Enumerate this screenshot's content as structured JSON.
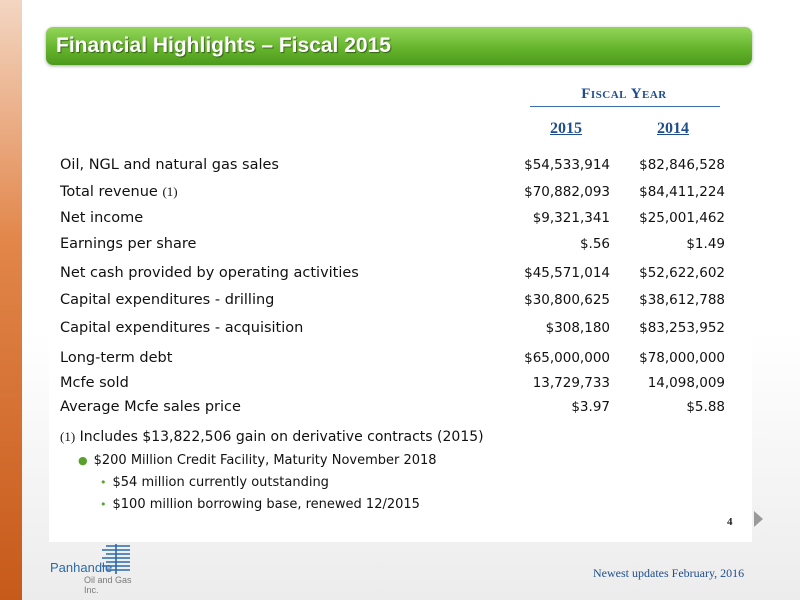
{
  "title": "Financial Highlights – Fiscal 2015",
  "table": {
    "group_header": "Fiscal Year",
    "years": [
      "2015",
      "2014"
    ],
    "rows": [
      {
        "label": "Oil, NGL and natural gas sales",
        "note": "",
        "v2015": "$54,533,914",
        "v2014": "$82,846,528"
      },
      {
        "label": "Total revenue",
        "note": "(1)",
        "v2015": "$70,882,093",
        "v2014": "$84,411,224"
      },
      {
        "label": "Net income",
        "note": "",
        "v2015": "$9,321,341",
        "v2014": "$25,001,462"
      },
      {
        "label": "Earnings per share",
        "note": "",
        "v2015": "$.56",
        "v2014": "$1.49"
      },
      {
        "label": "Net cash provided by operating activities",
        "note": "",
        "v2015": "$45,571,014",
        "v2014": "$52,622,602"
      },
      {
        "label": "Capital expenditures - drilling",
        "note": "",
        "v2015": "$30,800,625",
        "v2014": "$38,612,788"
      },
      {
        "label": "Capital expenditures - acquisition",
        "note": "",
        "v2015": "$308,180",
        "v2014": "$83,253,952"
      },
      {
        "label": "Long-term debt",
        "note": "",
        "v2015": "$65,000,000",
        "v2014": "$78,000,000"
      },
      {
        "label": "Mcfe sold",
        "note": "",
        "v2015": "13,729,733",
        "v2014": "14,098,009"
      },
      {
        "label": "Average Mcfe sales price",
        "note": "",
        "v2015": "$3.97",
        "v2014": "$5.88"
      }
    ]
  },
  "footnote": {
    "marker": "(1)",
    "text": "Includes $13,822,506 gain on derivative contracts (2015)"
  },
  "bullets": [
    "$200 Million Credit Facility, Maturity November 2018",
    "$54 million currently outstanding",
    "$100 million borrowing base, renewed 12/2015"
  ],
  "page_number": "4",
  "updates_note": "Newest updates February, 2016",
  "logo": {
    "name": "Panhandle",
    "sub": "Oil and Gas Inc."
  },
  "colors": {
    "title_green": "#66b52d",
    "header_blue": "#1f4e8c",
    "accent_orange": "#c65a1a"
  }
}
